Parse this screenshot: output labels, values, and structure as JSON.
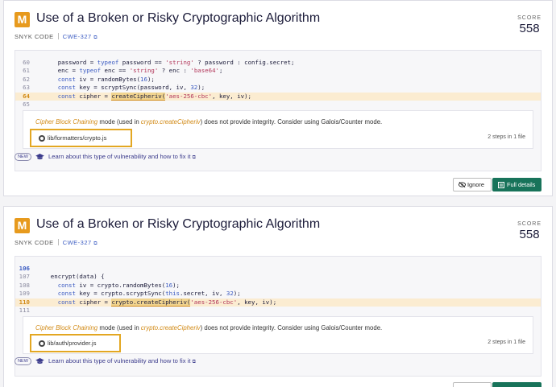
{
  "issues": [
    {
      "severity": "M",
      "title": "Use of a Broken or Risky Cryptographic Algorithm",
      "source": "SNYK CODE",
      "cwe": "CWE-327",
      "external_mark": "⧉",
      "score_label": "SCORE",
      "score": "558",
      "code": [
        {
          "n": "60",
          "parts": [
            [
              "t",
              "      password = "
            ],
            [
              "k",
              "typeof"
            ],
            [
              "t",
              " password == "
            ],
            [
              "s",
              "'string'"
            ],
            [
              "t",
              " ? password : config.secret;"
            ]
          ]
        },
        {
          "n": "61",
          "parts": [
            [
              "t",
              "      enc = "
            ],
            [
              "k",
              "typeof"
            ],
            [
              "t",
              " enc == "
            ],
            [
              "s",
              "'string'"
            ],
            [
              "t",
              " ? enc : "
            ],
            [
              "s",
              "'base64'"
            ],
            [
              "t",
              ";"
            ]
          ]
        },
        {
          "n": "62",
          "parts": [
            [
              "t",
              "      "
            ],
            [
              "k",
              "const"
            ],
            [
              "t",
              " iv = randomBytes("
            ],
            [
              "d",
              "16"
            ],
            [
              "t",
              ");"
            ]
          ]
        },
        {
          "n": "63",
          "parts": [
            [
              "t",
              "      "
            ],
            [
              "k",
              "const"
            ],
            [
              "t",
              " key = scryptSync(password, iv, "
            ],
            [
              "d",
              "32"
            ],
            [
              "t",
              ");"
            ]
          ]
        },
        {
          "n": "64",
          "active": true,
          "parts": [
            [
              "t",
              "      "
            ],
            [
              "k",
              "const"
            ],
            [
              "t",
              " cipher = "
            ],
            [
              "h",
              "createCipheriv("
            ],
            [
              "s",
              "'aes-256-cbc'"
            ],
            [
              "t",
              ", key, iv);"
            ]
          ]
        },
        {
          "n": "65",
          "parts": [
            [
              "t",
              ""
            ]
          ]
        }
      ],
      "message": {
        "highlight": "Cipher Block Chaining",
        "pre": " mode (used in ",
        "func": "crypto.createCipheriv",
        "post": ") does not provide integrity. Consider using Galois/Counter mode."
      },
      "file": "lib/formatters/crypto.js",
      "steps": "2 steps in 1 file",
      "badge": "NEW",
      "learn": "Learn about this type of vulnerability and how to fix it",
      "ignore": "Ignore",
      "full": "Full details"
    },
    {
      "severity": "M",
      "title": "Use of a Broken or Risky Cryptographic Algorithm",
      "source": "SNYK CODE",
      "cwe": "CWE-327",
      "external_mark": "⧉",
      "score_label": "SCORE",
      "score": "558",
      "code": [
        {
          "n": "106",
          "first": true,
          "parts": [
            [
              "t",
              ""
            ]
          ]
        },
        {
          "n": "107",
          "parts": [
            [
              "t",
              "    encrypt(data) {"
            ]
          ]
        },
        {
          "n": "108",
          "parts": [
            [
              "t",
              "      "
            ],
            [
              "k",
              "const"
            ],
            [
              "t",
              " iv = crypto.randomBytes("
            ],
            [
              "d",
              "16"
            ],
            [
              "t",
              ");"
            ]
          ]
        },
        {
          "n": "109",
          "parts": [
            [
              "t",
              "      "
            ],
            [
              "k",
              "const"
            ],
            [
              "t",
              " key = crypto.scryptSync("
            ],
            [
              "k",
              "this"
            ],
            [
              "t",
              ".secret, iv, "
            ],
            [
              "d",
              "32"
            ],
            [
              "t",
              ");"
            ]
          ]
        },
        {
          "n": "110",
          "active": true,
          "parts": [
            [
              "t",
              "      "
            ],
            [
              "k",
              "const"
            ],
            [
              "t",
              " cipher = "
            ],
            [
              "h",
              "crypto.createCipheriv("
            ],
            [
              "s",
              "'aes-256-cbc'"
            ],
            [
              "t",
              ", key, iv);"
            ]
          ]
        },
        {
          "n": "111",
          "parts": [
            [
              "t",
              ""
            ]
          ]
        }
      ],
      "message": {
        "highlight": "Cipher Block Chaining",
        "pre": " mode (used in ",
        "func": "crypto.createCipheriv",
        "post": ") does not provide integrity. Consider using Galois/Counter mode."
      },
      "file": "lib/auth/provider.js",
      "steps": "2 steps in 1 file",
      "badge": "NEW",
      "learn": "Learn about this type of vulnerability and how to fix it"
    }
  ],
  "colors": {
    "severity_medium": "#e79a1d",
    "primary_button": "#18735a",
    "link": "#3b3b8c",
    "highlight_box": "#e3a722"
  }
}
